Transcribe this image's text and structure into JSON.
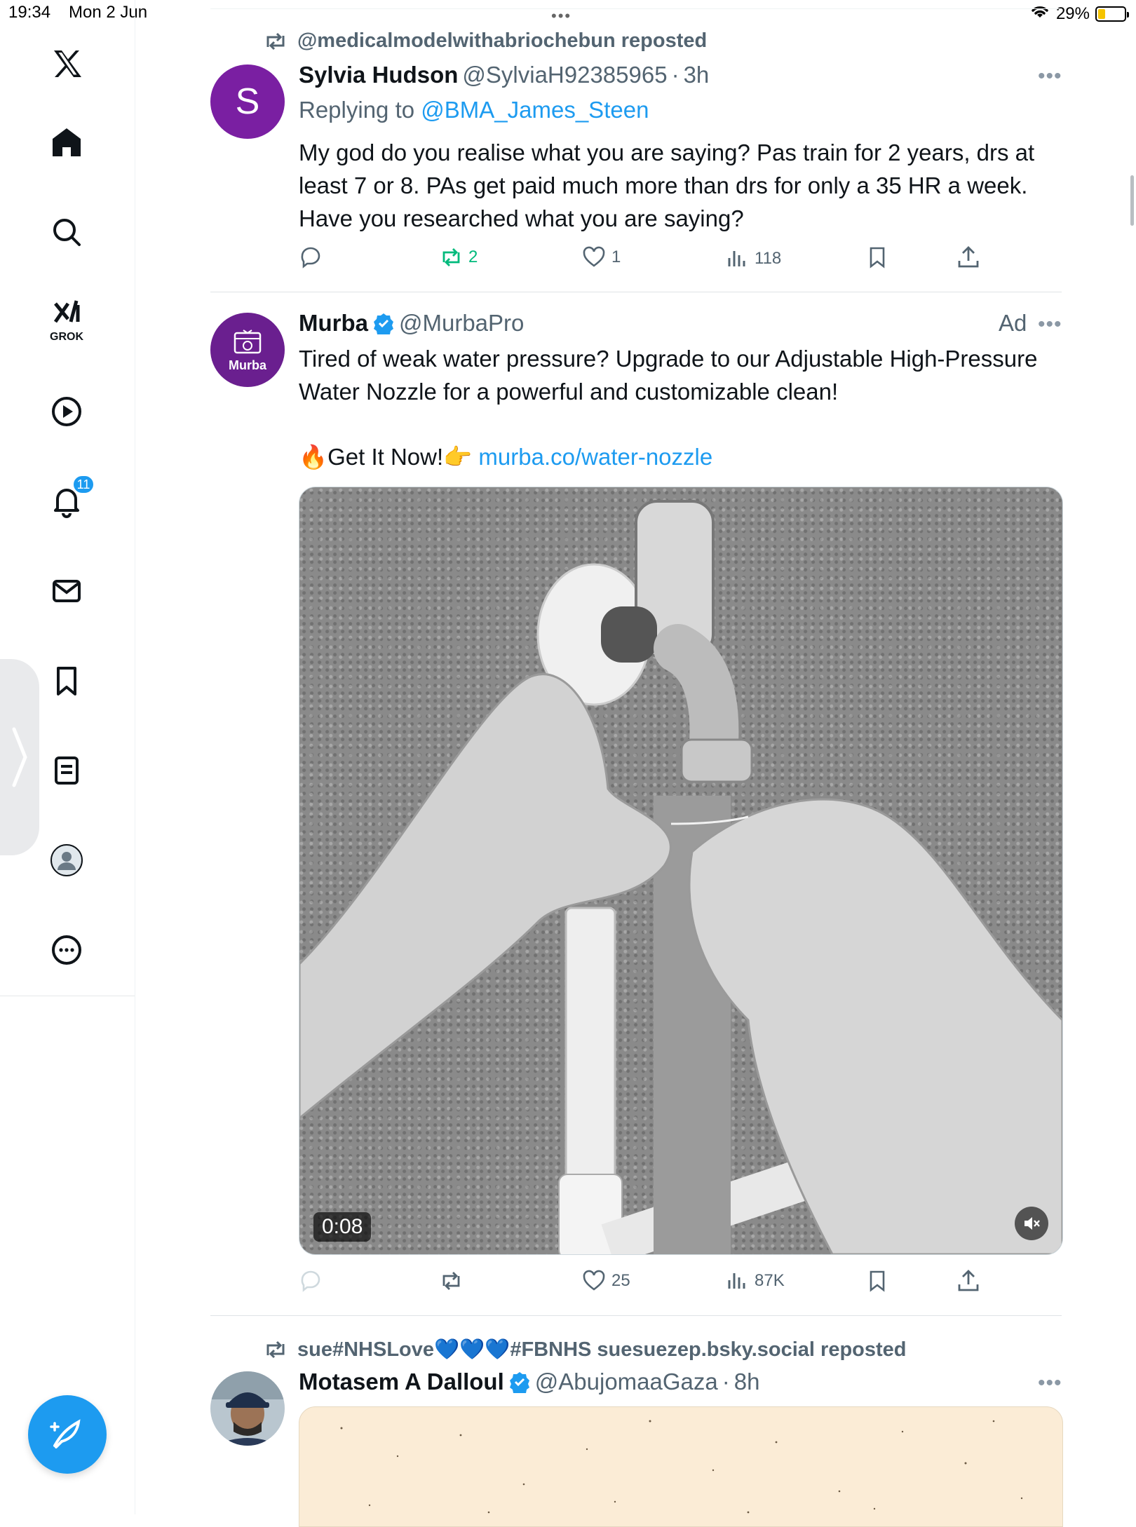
{
  "status_bar": {
    "time": "19:34",
    "date": "Mon 2 Jun",
    "battery": "29%",
    "battery_level": 0.29
  },
  "sidebar": {
    "items": [
      {
        "name": "home"
      },
      {
        "name": "explore"
      },
      {
        "name": "grok",
        "label": "GROK"
      },
      {
        "name": "videos"
      },
      {
        "name": "notifications",
        "badge": "11"
      },
      {
        "name": "messages"
      },
      {
        "name": "bookmarks"
      },
      {
        "name": "lists"
      },
      {
        "name": "profile"
      },
      {
        "name": "more"
      }
    ]
  },
  "tweets": [
    {
      "reposted_by": "@medicalmodelwithabriochebun reposted",
      "avatar_letter": "S",
      "avatar_color": "#7a1fa2",
      "name": "Sylvia Hudson",
      "handle": "@SylviaH92385965",
      "time": "3h",
      "replying_prefix": "Replying to ",
      "replying_to": "@BMA_James_Steen",
      "text": "My god do you realise what you are saying?    Pas train for 2 years, drs at least 7 or 8.   PAs get paid much more than drs for only a 35 HR a week.   Have you researched what you are saying?",
      "actions": {
        "replies": "",
        "reposts": "2",
        "likes": "1",
        "views": "118"
      }
    },
    {
      "name": "Murba",
      "handle": "@MurbaPro",
      "verified": true,
      "ad_label": "Ad",
      "avatar_label": "Murba",
      "avatar_color": "#6a1f8f",
      "text": "Tired of weak water pressure? Upgrade to our Adjustable High-Pressure Water Nozzle for a powerful and customizable clean!",
      "cta_prefix": "🔥Get It Now!👉 ",
      "cta_link": "murba.co/water-nozzle",
      "video_time": "0:08",
      "actions": {
        "replies": "",
        "reposts": "",
        "likes": "25",
        "views": "87K"
      }
    },
    {
      "reposted_by": "sue#NHSLove💙💙💙#FBNHS suesuezep.bsky.social reposted",
      "name": "Motasem A Dalloul",
      "handle": "@AbujomaaGaza",
      "verified": true,
      "time": "8h"
    }
  ],
  "separator": "·",
  "more_glyph": "•••",
  "colors": {
    "accent": "#1d9bf0",
    "repost_green": "#00ba7c",
    "muted": "#536471"
  }
}
